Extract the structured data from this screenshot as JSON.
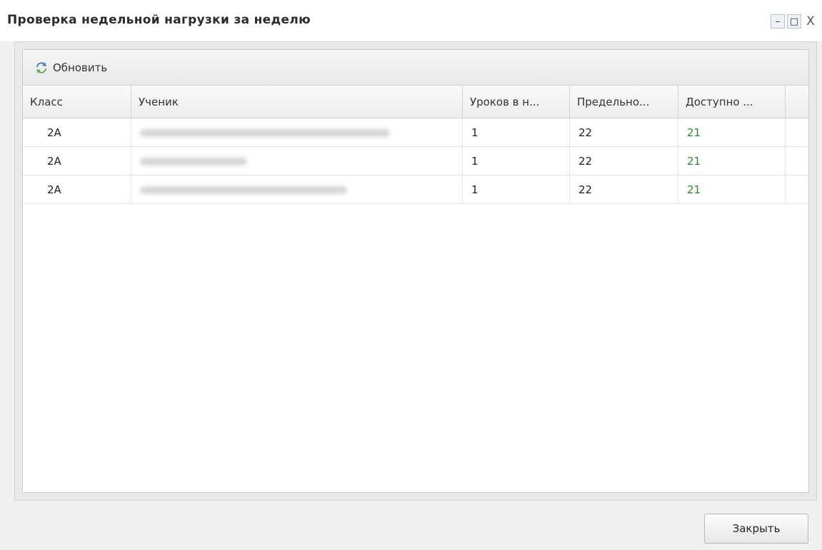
{
  "window": {
    "title": "Проверка недельной нагрузки за неделю",
    "controls": {
      "minimize": "–",
      "maximize": "□",
      "close": "X"
    }
  },
  "toolbar": {
    "refresh_label": "Обновить",
    "refresh_icon": "refresh-icon"
  },
  "grid": {
    "columns": [
      "Класс",
      "Ученик",
      "Уроков в н...",
      "Предельно...",
      "Доступно ..."
    ],
    "rows": [
      {
        "class": "2А",
        "student": "",
        "lessons": "1",
        "limit": "22",
        "available": "21"
      },
      {
        "class": "2А",
        "student": "",
        "lessons": "1",
        "limit": "22",
        "available": "21"
      },
      {
        "class": "2А",
        "student": "",
        "lessons": "1",
        "limit": "22",
        "available": "21"
      }
    ]
  },
  "footer": {
    "close_label": "Закрыть"
  },
  "colors": {
    "available_value": "#2e8a2e",
    "title_text": "#2b2b2b"
  }
}
